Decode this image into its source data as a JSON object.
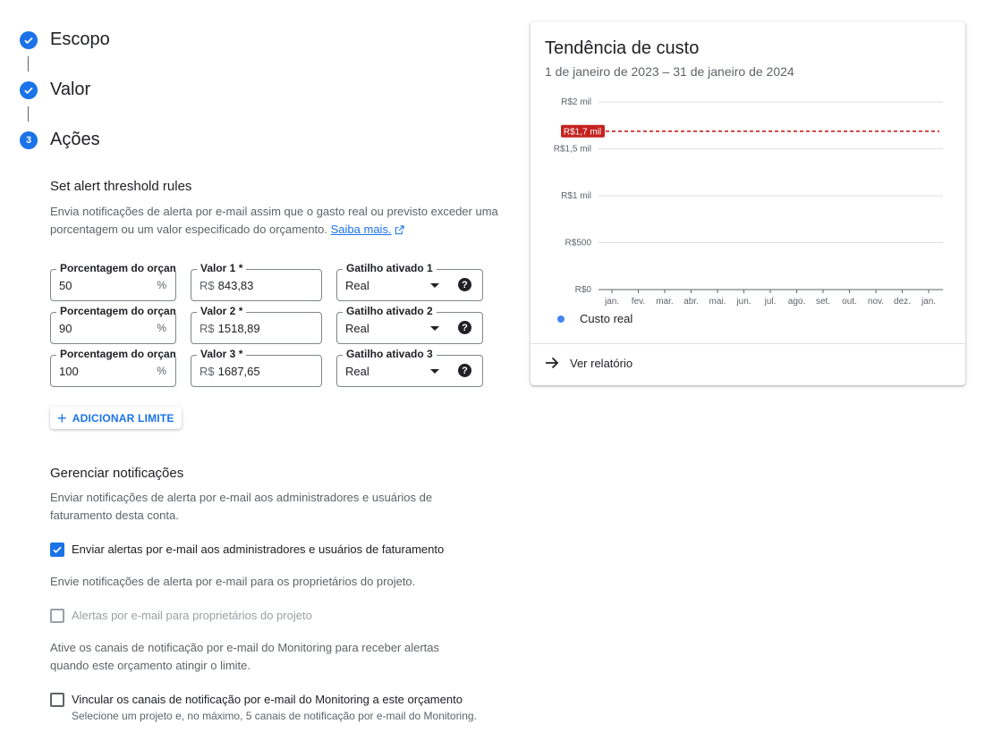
{
  "stepper": {
    "steps": [
      {
        "label": "Escopo",
        "state": "done"
      },
      {
        "label": "Valor",
        "state": "done"
      },
      {
        "label": "Ações",
        "state": "current",
        "number": "3"
      }
    ]
  },
  "threshold": {
    "title": "Set alert threshold rules",
    "description": "Envia notificações de alerta por e-mail assim que o gasto real ou previsto exceder uma porcentagem ou um valor especificado do orçamento.",
    "learn_more": "Saiba mais.",
    "rows": [
      {
        "percent_label": "Porcentagem do orçamento",
        "percent": "50",
        "percent_suffix": "%",
        "amount_label": "Valor 1 *",
        "currency": "R$",
        "amount": "843,83",
        "trigger_label": "Gatilho ativado 1",
        "trigger": "Real"
      },
      {
        "percent_label": "Porcentagem do orçamento",
        "percent": "90",
        "percent_suffix": "%",
        "amount_label": "Valor 2 *",
        "currency": "R$",
        "amount": "1518,89",
        "trigger_label": "Gatilho ativado 2",
        "trigger": "Real"
      },
      {
        "percent_label": "Porcentagem do orçamento",
        "percent": "100",
        "percent_suffix": "%",
        "amount_label": "Valor 3 *",
        "currency": "R$",
        "amount": "1687,65",
        "trigger_label": "Gatilho ativado 3",
        "trigger": "Real"
      }
    ],
    "add_button": "ADICIONAR LIMITE"
  },
  "notifications": {
    "title": "Gerenciar notificações",
    "description": "Enviar notificações de alerta por e-mail aos administradores e usuários de faturamento desta conta.",
    "cb_admins": {
      "label": "Enviar alertas por e-mail aos administradores e usuários de faturamento",
      "checked": true
    },
    "owners_desc": "Envie notificações de alerta por e-mail para os proprietários do projeto.",
    "cb_owners": {
      "label": "Alertas por e-mail para proprietários do projeto",
      "checked": false,
      "disabled": true
    },
    "monitoring_desc": "Ative os canais de notificação por e-mail do Monitoring para receber alertas quando este orçamento atingir o limite.",
    "cb_monitoring": {
      "label": "Vincular os canais de notificação por e-mail do Monitoring a este orçamento",
      "checked": false
    },
    "monitoring_hint": "Selecione um projeto e, no máximo, 5 canais de notificação por e-mail do Monitoring."
  },
  "card": {
    "title": "Tendência de custo",
    "subtitle": "1 de janeiro de 2023 – 31 de janeiro de 2024",
    "legend": "Custo real",
    "link": "Ver relatório"
  },
  "chart_data": {
    "type": "line",
    "x": [
      "jan.",
      "fev.",
      "mar.",
      "abr.",
      "mai.",
      "jun.",
      "jul.",
      "ago.",
      "set.",
      "out.",
      "nov.",
      "dez.",
      "jan."
    ],
    "y_ticks": [
      0,
      500,
      1000,
      1500,
      2000
    ],
    "y_tick_labels": [
      "R$0",
      "R$500",
      "R$1 mil",
      "R$1,5 mil",
      "R$2 mil"
    ],
    "ylim": [
      0,
      2000
    ],
    "series": [
      {
        "name": "Custo real",
        "values": [],
        "color": "#4285f4"
      }
    ],
    "threshold_line": {
      "value": 1687.65,
      "label": "R$1,7 mil",
      "color": "#c5221f",
      "style": "dashed"
    },
    "grid": true
  }
}
